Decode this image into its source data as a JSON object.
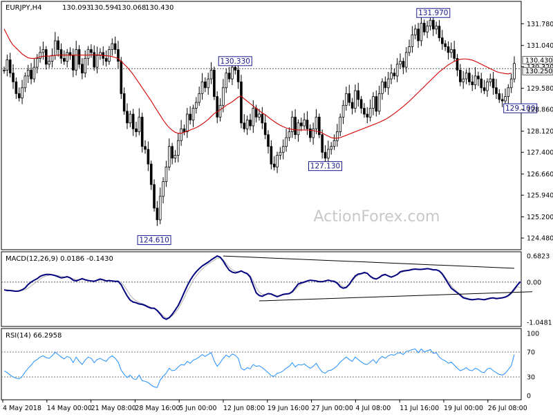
{
  "chart_data": [
    {
      "type": "candlestick",
      "title": "EURJPY,H4",
      "ohlc": {
        "open": "130.093",
        "high": "130.594",
        "low": "130.068",
        "close": "130.430"
      },
      "watermark": "ActionForex.com",
      "ylim": [
        124.2,
        132.4
      ],
      "y_ticks": [
        "131.780",
        "131.040",
        "130.320",
        "129.580",
        "128.860",
        "128.120",
        "127.400",
        "126.660",
        "125.940",
        "125.200",
        "124.480"
      ],
      "price_tags": [
        "130.430",
        "130.250"
      ],
      "pivot_labels": [
        {
          "text": "131.970",
          "bar": 143,
          "value": 131.97
        },
        {
          "text": "130.330",
          "bar": 77,
          "value": 130.33
        },
        {
          "text": "129.100",
          "bar": 172,
          "value": 129.1
        },
        {
          "text": "127.130",
          "bar": 107,
          "value": 127.13
        },
        {
          "text": "124.610",
          "bar": 50,
          "value": 124.61
        }
      ],
      "close": [
        130.2,
        130.55,
        130.1,
        129.8,
        129.4,
        129.25,
        129.6,
        130.0,
        130.2,
        129.9,
        130.3,
        130.6,
        130.8,
        130.9,
        130.4,
        130.5,
        130.7,
        131.2,
        130.9,
        130.6,
        130.5,
        130.8,
        130.7,
        130.2,
        130.9,
        130.4,
        130.1,
        130.6,
        130.9,
        130.8,
        130.3,
        130.7,
        130.8,
        130.6,
        130.5,
        130.9,
        131.1,
        130.9,
        130.5,
        129.4,
        128.8,
        128.4,
        128.7,
        128.2,
        128.1,
        128.6,
        127.6,
        127.5,
        127.0,
        126.3,
        125.5,
        125.1,
        125.9,
        126.4,
        126.9,
        127.6,
        127.2,
        127.3,
        127.8,
        128.2,
        128.1,
        128.7,
        128.5,
        128.9,
        129.1,
        129.4,
        129.8,
        129.6,
        129.9,
        130.2,
        129.3,
        128.6,
        129.0,
        129.6,
        130.1,
        129.9,
        130.3,
        130.2,
        129.8,
        128.4,
        128.2,
        128.5,
        128.3,
        128.9,
        128.6,
        128.7,
        128.4,
        128.0,
        127.6,
        127.0,
        126.9,
        127.3,
        127.4,
        127.6,
        127.9,
        128.1,
        128.6,
        128.0,
        128.4,
        128.3,
        128.5,
        128.2,
        127.9,
        128.2,
        128.6,
        128.0,
        127.4,
        127.2,
        127.5,
        127.6,
        127.8,
        128.1,
        128.6,
        129.0,
        129.4,
        129.1,
        128.9,
        129.5,
        129.2,
        128.9,
        128.7,
        128.6,
        128.9,
        129.3,
        128.8,
        129.4,
        129.8,
        129.6,
        129.9,
        130.1,
        130.0,
        130.4,
        130.5,
        130.3,
        130.8,
        131.0,
        131.4,
        131.6,
        131.2,
        131.8,
        131.5,
        131.7,
        131.9,
        131.6,
        131.7,
        131.3,
        131.1,
        131.0,
        130.8,
        130.9,
        130.6,
        130.2,
        129.8,
        129.9,
        130.1,
        129.8,
        129.7,
        130.0,
        129.9,
        129.6,
        129.5,
        129.8,
        129.9,
        129.6,
        129.4,
        129.2,
        129.15,
        129.3,
        129.6,
        129.9,
        130.43
      ],
      "sma": {
        "color": "#d40000",
        "values": [
          131.6,
          131.4,
          131.2,
          131.05,
          130.95,
          130.85,
          130.75,
          130.68,
          130.62,
          130.6,
          130.6,
          130.62,
          130.65,
          130.67,
          130.68,
          130.68,
          130.69,
          130.7,
          130.71,
          130.71,
          130.71,
          130.71,
          130.71,
          130.71,
          130.71,
          130.71,
          130.71,
          130.71,
          130.71,
          130.72,
          130.72,
          130.72,
          130.71,
          130.7,
          130.69,
          130.68,
          130.66,
          130.63,
          130.6,
          130.5,
          130.4,
          130.3,
          130.18,
          130.05,
          129.9,
          129.75,
          129.6,
          129.45,
          129.3,
          129.15,
          128.98,
          128.82,
          128.66,
          128.5,
          128.36,
          128.24,
          128.15,
          128.08,
          128.05,
          128.05,
          128.08,
          128.12,
          128.16,
          128.2,
          128.24,
          128.3,
          128.36,
          128.44,
          128.52,
          128.62,
          128.72,
          128.78,
          128.85,
          128.92,
          129.0,
          129.06,
          129.12,
          129.2,
          129.28,
          129.32,
          129.22,
          129.14,
          129.06,
          128.98,
          128.9,
          128.82,
          128.74,
          128.68,
          128.6,
          128.52,
          128.45,
          128.38,
          128.32,
          128.27,
          128.23,
          128.2,
          128.18,
          128.17,
          128.16,
          128.16,
          128.16,
          128.16,
          128.15,
          128.14,
          128.12,
          128.1,
          128.06,
          128.0,
          127.95,
          127.9,
          127.88,
          127.88,
          127.9,
          127.94,
          127.98,
          128.02,
          128.06,
          128.1,
          128.14,
          128.18,
          128.22,
          128.26,
          128.3,
          128.34,
          128.38,
          128.42,
          128.47,
          128.52,
          128.58,
          128.65,
          128.72,
          128.8,
          128.88,
          128.96,
          129.05,
          129.14,
          129.24,
          129.34,
          129.44,
          129.54,
          129.64,
          129.74,
          129.84,
          129.94,
          130.04,
          130.14,
          130.22,
          130.3,
          130.38,
          130.44,
          130.5,
          130.54,
          130.57,
          130.58,
          130.58,
          130.56,
          130.54,
          130.5,
          130.45,
          130.4,
          130.35,
          130.3,
          130.25,
          130.2,
          130.15,
          130.12,
          130.1,
          130.08,
          130.07,
          130.1
        ]
      },
      "reference_line": 130.25
    },
    {
      "type": "line",
      "title": "MACD(12,26,9) 0.0186 -0.1430",
      "ylim": [
        -1.0481,
        0.6823
      ],
      "y_ticks": [
        "0.6823",
        "0.00",
        "-1.0481"
      ],
      "zero_line": 0,
      "macd": {
        "color": "#00007f",
        "values": [
          -0.2,
          -0.22,
          -0.22,
          -0.23,
          -0.24,
          -0.23,
          -0.2,
          -0.15,
          -0.06,
          0.0,
          0.05,
          0.09,
          0.15,
          0.18,
          0.2,
          0.2,
          0.19,
          0.17,
          0.14,
          0.11,
          0.12,
          0.14,
          0.11,
          0.05,
          0.03,
          0.06,
          0.09,
          0.06,
          0.04,
          0.03,
          0.02,
          0.05,
          0.08,
          0.06,
          0.03,
          0.04,
          0.03,
          0.02,
          0.02,
          -0.07,
          -0.22,
          -0.36,
          -0.47,
          -0.52,
          -0.54,
          -0.57,
          -0.58,
          -0.61,
          -0.65,
          -0.68,
          -0.68,
          -0.74,
          -0.83,
          -0.93,
          -0.97,
          -0.93,
          -0.84,
          -0.73,
          -0.61,
          -0.45,
          -0.27,
          -0.1,
          0.05,
          0.17,
          0.27,
          0.35,
          0.42,
          0.47,
          0.52,
          0.58,
          0.63,
          0.68,
          0.65,
          0.55,
          0.42,
          0.31,
          0.26,
          0.24,
          0.26,
          0.29,
          0.25,
          0.22,
          0.13,
          -0.08,
          -0.28,
          -0.35,
          -0.37,
          -0.33,
          -0.3,
          -0.31,
          -0.35,
          -0.38,
          -0.35,
          -0.32,
          -0.31,
          -0.3,
          -0.25,
          -0.15,
          -0.05,
          -0.02,
          0.0,
          0.03,
          0.05,
          0.04,
          0.03,
          0.01,
          0.01,
          0.03,
          0.05,
          0.03,
          0.02,
          -0.03,
          -0.12,
          -0.16,
          -0.14,
          -0.06,
          0.06,
          0.16,
          0.21,
          0.22,
          0.25,
          0.23,
          0.15,
          0.1,
          0.08,
          0.12,
          0.18,
          0.2,
          0.16,
          0.13,
          0.16,
          0.2,
          0.27,
          0.29,
          0.3,
          0.31,
          0.33,
          0.34,
          0.33,
          0.33,
          0.34,
          0.35,
          0.34,
          0.32,
          0.32,
          0.29,
          0.21,
          0.09,
          -0.04,
          -0.16,
          -0.22,
          -0.28,
          -0.34,
          -0.41,
          -0.43,
          -0.45,
          -0.46,
          -0.45,
          -0.44,
          -0.45,
          -0.46,
          -0.44,
          -0.42,
          -0.41,
          -0.43,
          -0.42,
          -0.41,
          -0.39,
          -0.35,
          -0.28,
          -0.18,
          -0.08,
          0.01
        ]
      },
      "signal": {
        "color": "#b0b0b0",
        "values": [
          -0.2,
          -0.2,
          -0.21,
          -0.22,
          -0.23,
          -0.23,
          -0.22,
          -0.2,
          -0.16,
          -0.1,
          -0.04,
          0.02,
          0.08,
          0.13,
          0.16,
          0.18,
          0.19,
          0.18,
          0.17,
          0.15,
          0.14,
          0.14,
          0.12,
          0.09,
          0.06,
          0.06,
          0.07,
          0.07,
          0.05,
          0.04,
          0.03,
          0.04,
          0.05,
          0.05,
          0.04,
          0.04,
          0.04,
          0.03,
          0.03,
          -0.01,
          -0.1,
          -0.22,
          -0.34,
          -0.43,
          -0.49,
          -0.53,
          -0.56,
          -0.59,
          -0.63,
          -0.66,
          -0.69,
          -0.73,
          -0.8,
          -0.88,
          -0.93,
          -0.93,
          -0.88,
          -0.8,
          -0.7,
          -0.56,
          -0.41,
          -0.24,
          -0.1,
          0.05,
          0.16,
          0.26,
          0.34,
          0.41,
          0.47,
          0.52,
          0.57,
          0.62,
          0.63,
          0.58,
          0.49,
          0.39,
          0.32,
          0.28,
          0.28,
          0.28,
          0.26,
          0.23,
          0.17,
          0.03,
          -0.14,
          -0.26,
          -0.32,
          -0.32,
          -0.3,
          -0.3,
          -0.33,
          -0.36,
          -0.35,
          -0.33,
          -0.31,
          -0.3,
          -0.27,
          -0.2,
          -0.11,
          -0.05,
          -0.02,
          0.01,
          0.04,
          0.04,
          0.03,
          0.02,
          0.02,
          0.03,
          0.04,
          0.03,
          0.02,
          0.0,
          -0.07,
          -0.12,
          -0.13,
          -0.08,
          0.02,
          0.12,
          0.18,
          0.21,
          0.23,
          0.22,
          0.17,
          0.12,
          0.09,
          0.11,
          0.16,
          0.18,
          0.16,
          0.14,
          0.16,
          0.19,
          0.24,
          0.27,
          0.29,
          0.3,
          0.32,
          0.33,
          0.33,
          0.33,
          0.33,
          0.34,
          0.34,
          0.33,
          0.32,
          0.3,
          0.24,
          0.13,
          0.02,
          -0.1,
          -0.18,
          -0.25,
          -0.31,
          -0.38,
          -0.41,
          -0.43,
          -0.45,
          -0.45,
          -0.44,
          -0.44,
          -0.45,
          -0.44,
          -0.43,
          -0.42,
          -0.42,
          -0.42,
          -0.41,
          -0.4,
          -0.37,
          -0.31,
          -0.22,
          -0.12,
          -0.14
        ]
      }
    },
    {
      "type": "line",
      "title": "RSI(14) 66.2958",
      "ylim": [
        0,
        100
      ],
      "y_ticks": [
        "100",
        "70",
        "30",
        "0"
      ],
      "levels": [
        70,
        30
      ],
      "rsi": {
        "color": "#1e90ff",
        "values": [
          40,
          37,
          33,
          30,
          28,
          27,
          31,
          38,
          44,
          49,
          55,
          58,
          62,
          64,
          61,
          60,
          64,
          70,
          66,
          62,
          59,
          63,
          61,
          53,
          62,
          55,
          50,
          57,
          62,
          60,
          53,
          58,
          60,
          57,
          55,
          61,
          64,
          60,
          54,
          41,
          34,
          29,
          33,
          27,
          26,
          33,
          24,
          23,
          21,
          17,
          14,
          13,
          25,
          31,
          36,
          44,
          40,
          41,
          46,
          50,
          49,
          55,
          52,
          57,
          59,
          62,
          66,
          63,
          66,
          69,
          56,
          47,
          53,
          60,
          65,
          62,
          67,
          65,
          60,
          44,
          41,
          45,
          43,
          50,
          47,
          48,
          45,
          41,
          37,
          32,
          31,
          36,
          37,
          40,
          44,
          47,
          53,
          46,
          50,
          49,
          51,
          47,
          44,
          47,
          52,
          44,
          38,
          36,
          40,
          41,
          44,
          48,
          54,
          58,
          62,
          58,
          55,
          62,
          58,
          54,
          51,
          50,
          54,
          58,
          52,
          59,
          63,
          60,
          64,
          66,
          65,
          68,
          69,
          66,
          71,
          72,
          74,
          75,
          69,
          75,
          70,
          72,
          74,
          68,
          69,
          62,
          58,
          56,
          52,
          54,
          49,
          44,
          40,
          42,
          45,
          41,
          40,
          44,
          42,
          38,
          37,
          43,
          44,
          40,
          37,
          34,
          33,
          36,
          42,
          48,
          66
        ]
      }
    }
  ],
  "x_axis": {
    "labels": [
      "4 May 2018",
      "14 May 00:00",
      "21 May 08:00",
      "28 May 16:00",
      "5 Jun 00:00",
      "12 Jun 08:00",
      "19 Jun 16:00",
      "27 Jun 00:00",
      "4 Jul 08:00",
      "11 Jul 16:00",
      "19 Jul 00:00",
      "26 Jul 08:00"
    ]
  },
  "colors": {
    "candle": "#000000",
    "frame": "#000000",
    "label_box": "#1a1a8c"
  }
}
